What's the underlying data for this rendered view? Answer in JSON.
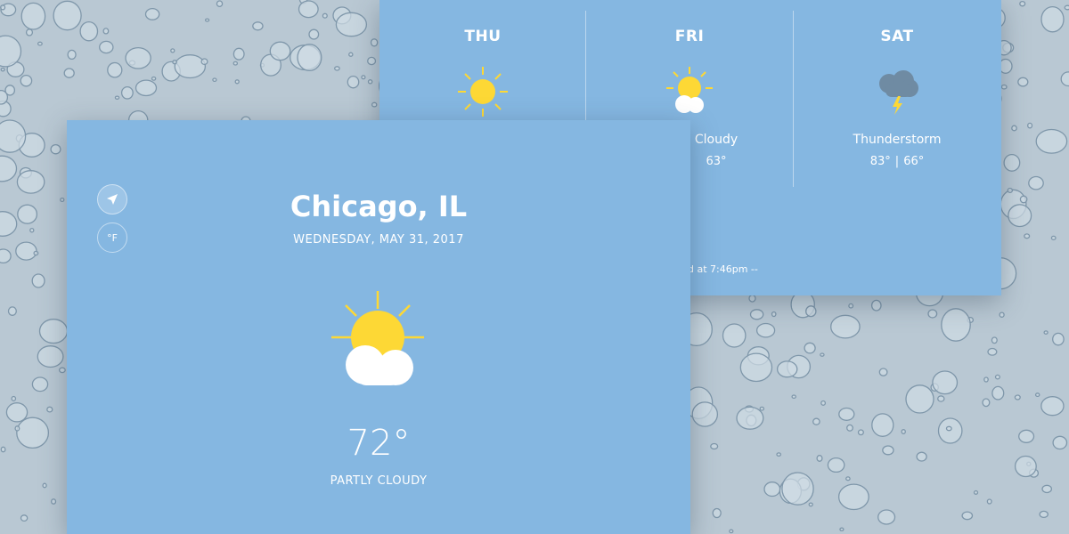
{
  "colors": {
    "card": "#85b7e1",
    "sun": "#fdd835",
    "cloud": "#ffffff",
    "storm_cloud": "#6f8ba3",
    "text": "#ffffff",
    "background": "#b9c8d3"
  },
  "current": {
    "city": "Chicago, IL",
    "date": "WEDNESDAY, MAY 31, 2017",
    "temperature": "72°",
    "condition": "PARTLY CLOUDY",
    "icon": "partly-cloudy-icon",
    "location_button_icon": "location-arrow-icon",
    "unit_label": "°F"
  },
  "forecast": [
    {
      "day": "THU",
      "icon": "sun-icon",
      "condition": "",
      "high": "",
      "low": ""
    },
    {
      "day": "FRI",
      "icon": "partly-cloudy-icon",
      "condition": "Cloudy",
      "high": "",
      "low": "63°"
    },
    {
      "day": "SAT",
      "icon": "thunderstorm-icon",
      "condition": "Thunderstorm",
      "high": "83°",
      "low": "66°",
      "separator": "|"
    }
  ],
  "updated_text": "d at 7:46pm --"
}
